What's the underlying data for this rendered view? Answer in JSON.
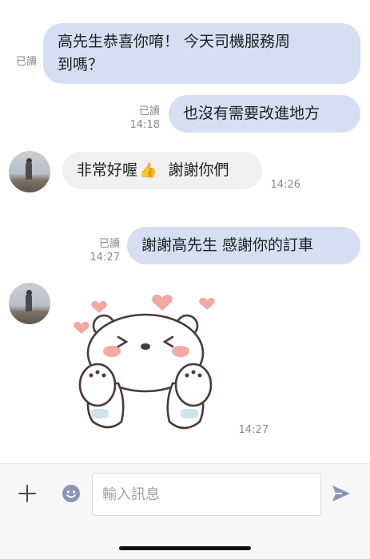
{
  "messages": [
    {
      "text": "高先生恭喜你唷！ 今天司機服務周到嗎？",
      "line1": "高先生恭喜你唷！ 今天司機服務周",
      "line2": "到嗎？",
      "read": "已讀",
      "time": ""
    },
    {
      "text": "也沒有需要改進地方",
      "read": "已讀",
      "time": "14:18"
    },
    {
      "text": "非常好喔",
      "text2": "謝謝你們",
      "emoji": "👍",
      "time": "14:26"
    },
    {
      "text": "謝謝高先生 感謝你的訂車",
      "read": "已讀",
      "time": "14:27"
    },
    {
      "sticker": "bear-love-sticker",
      "time": "14:27"
    }
  ],
  "input": {
    "placeholder": "輸入訊息"
  },
  "icons": {
    "plus": "plus-icon",
    "emoji": "emoji-icon",
    "send": "send-icon"
  },
  "colors": {
    "outgoing_bubble": "#d5def2",
    "incoming_bubble": "#f0f0f1",
    "accent": "#8a93b8"
  }
}
